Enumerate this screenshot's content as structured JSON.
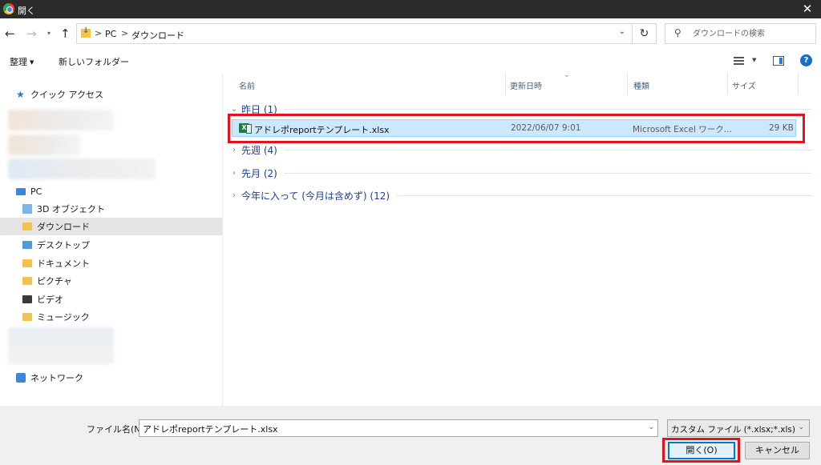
{
  "window": {
    "title": "開く",
    "close_glyph": "✕"
  },
  "nav": {
    "back_glyph": "←",
    "forward_glyph": "→",
    "recent_glyph": "▾",
    "up_glyph": "↑",
    "refresh_glyph": "↻"
  },
  "address": {
    "crumbs": [
      "PC",
      "ダウンロード"
    ],
    "separator": ">",
    "dropdown_glyph": "⌄"
  },
  "search": {
    "placeholder": "ダウンロードの検索"
  },
  "toolbar": {
    "organize_label": "整理",
    "new_folder_label": "新しいフォルダー",
    "help_glyph": "?"
  },
  "sidebar": {
    "quick_access": "クイック アクセス",
    "pc": "PC",
    "items": [
      {
        "label": "3D オブジェクト",
        "icon": "3d-objects-icon"
      },
      {
        "label": "ダウンロード",
        "icon": "downloads-folder-icon"
      },
      {
        "label": "デスクトップ",
        "icon": "desktop-folder-icon"
      },
      {
        "label": "ドキュメント",
        "icon": "documents-folder-icon"
      },
      {
        "label": "ピクチャ",
        "icon": "pictures-folder-icon"
      },
      {
        "label": "ビデオ",
        "icon": "videos-folder-icon"
      },
      {
        "label": "ミュージック",
        "icon": "music-folder-icon"
      }
    ],
    "network": "ネットワーク"
  },
  "columns": {
    "name": "名前",
    "modified": "更新日時",
    "type": "種類",
    "size": "サイズ"
  },
  "groups": [
    {
      "label": "昨日 (1)",
      "expanded": true
    },
    {
      "label": "先週 (4)",
      "expanded": false
    },
    {
      "label": "先月 (2)",
      "expanded": false
    },
    {
      "label": "今年に入って (今月は含めず) (12)",
      "expanded": false
    }
  ],
  "file": {
    "name": "アドレポreportテンプレート.xlsx",
    "modified": "2022/06/07 9:01",
    "type": "Microsoft Excel ワーク...",
    "size": "29 KB",
    "icon_letter": "X"
  },
  "footer": {
    "filename_label": "ファイル名(N):",
    "filename_value": "アドレポreportテンプレート.xlsx",
    "filetype_value": "カスタム ファイル (*.xlsx;*.xls)",
    "open_label": "開く(O)",
    "cancel_label": "キャンセル"
  },
  "colors": {
    "selection": "#cce8ff",
    "highlight_red": "#e0141e",
    "titlebar": "#2b2b2b",
    "group_text": "#1e3f8a"
  }
}
